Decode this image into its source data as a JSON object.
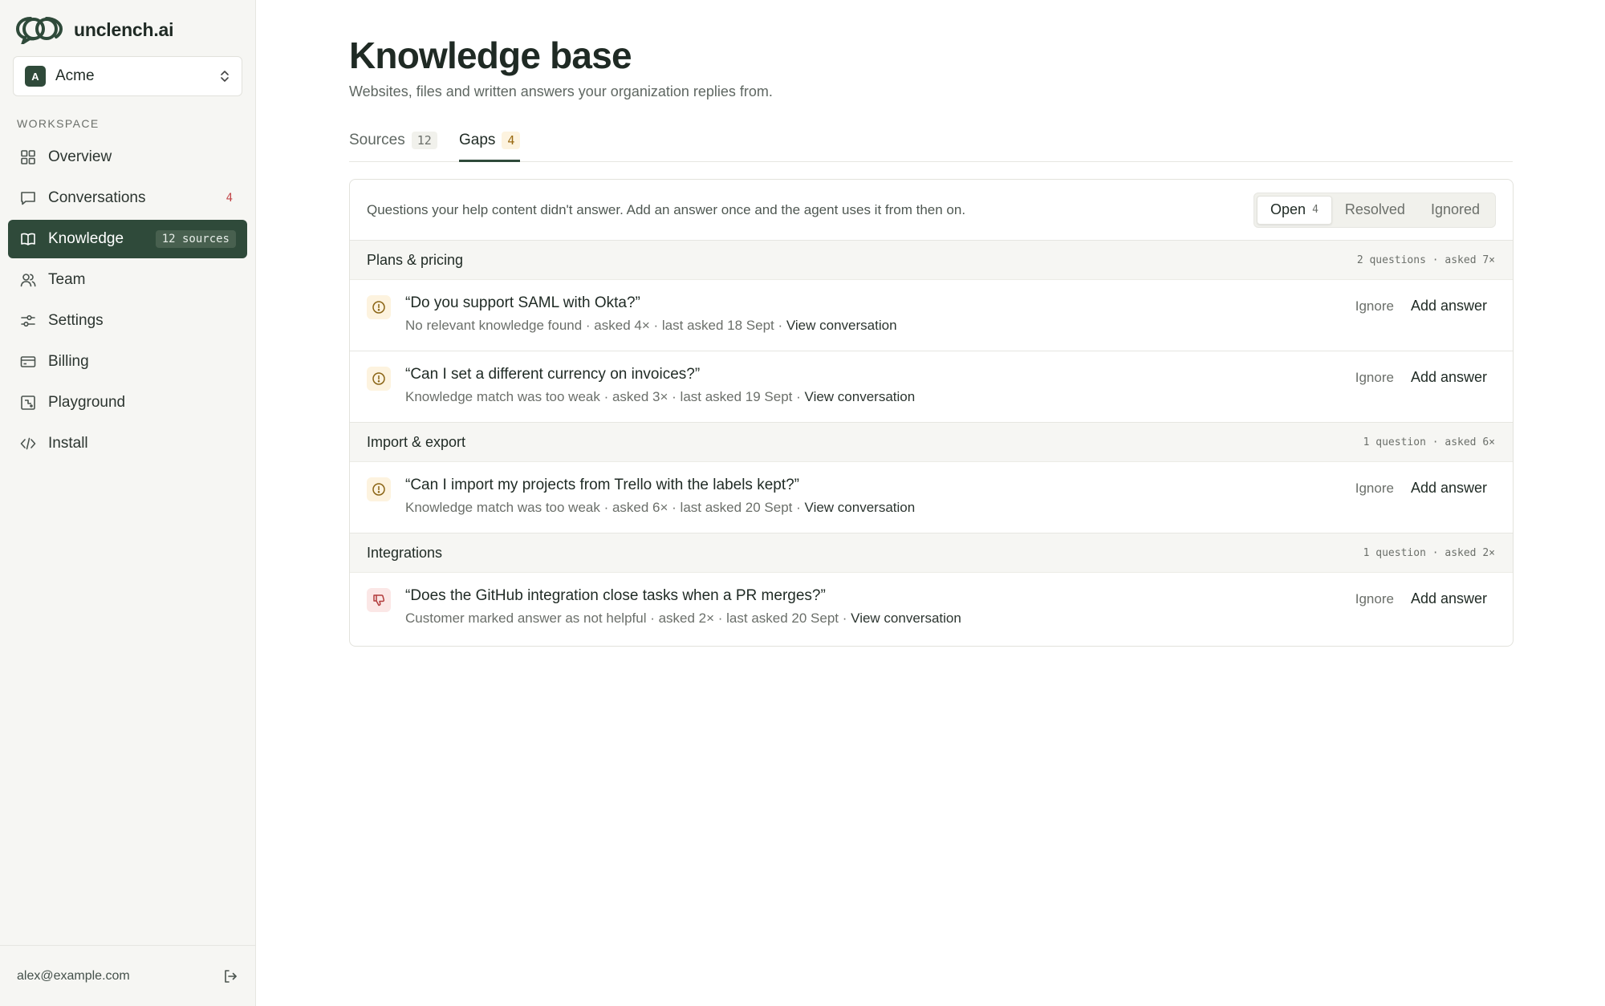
{
  "brand": {
    "name": "unclench.ai"
  },
  "org": {
    "initial": "A",
    "name": "Acme"
  },
  "sidebar": {
    "section_label": "WORKSPACE",
    "items": [
      {
        "label": "Overview",
        "icon": "grid-icon"
      },
      {
        "label": "Conversations",
        "icon": "chat-icon",
        "badge": "4"
      },
      {
        "label": "Knowledge",
        "icon": "book-icon",
        "badge": "12 sources",
        "active": true
      },
      {
        "label": "Team",
        "icon": "users-icon"
      },
      {
        "label": "Settings",
        "icon": "sliders-icon"
      },
      {
        "label": "Billing",
        "icon": "card-icon"
      },
      {
        "label": "Playground",
        "icon": "playground-icon"
      },
      {
        "label": "Install",
        "icon": "code-icon"
      }
    ],
    "user_email": "alex@example.com"
  },
  "page": {
    "title": "Knowledge base",
    "subtitle": "Websites, files and written answers your organization replies from."
  },
  "tabs": [
    {
      "label": "Sources",
      "count": "12"
    },
    {
      "label": "Gaps",
      "count": "4",
      "active": true
    }
  ],
  "gaps": {
    "description": "Questions your help content didn't answer. Add an answer once and the agent uses it from then on.",
    "filters": [
      {
        "label": "Open",
        "count": "4",
        "active": true
      },
      {
        "label": "Resolved"
      },
      {
        "label": "Ignored"
      }
    ],
    "ignore_label": "Ignore",
    "add_label": "Add answer",
    "view_label": "View conversation",
    "groups": [
      {
        "title": "Plans & pricing",
        "meta": "2 questions · asked 7×",
        "questions": [
          {
            "text": "“Do you support SAML with Okta?”",
            "meta": "No relevant knowledge found · asked 4× · last asked 18 Sept ·",
            "icon": "warning-icon"
          },
          {
            "text": "“Can I set a different currency on invoices?”",
            "meta": "Knowledge match was too weak · asked 3× · last asked 19 Sept ·",
            "icon": "warning-icon"
          }
        ]
      },
      {
        "title": "Import & export",
        "meta": "1 question · asked 6×",
        "questions": [
          {
            "text": "“Can I import my projects from Trello with the labels kept?”",
            "meta": "Knowledge match was too weak · asked 6× · last asked 20 Sept ·",
            "icon": "warning-icon"
          }
        ]
      },
      {
        "title": "Integrations",
        "meta": "1 question · asked 2×",
        "questions": [
          {
            "text": "“Does the GitHub integration close tasks when a PR merges?”",
            "meta": "Customer marked answer as not helpful · asked 2× · last asked 20 Sept ·",
            "icon": "thumbs-down-icon"
          }
        ]
      }
    ]
  }
}
